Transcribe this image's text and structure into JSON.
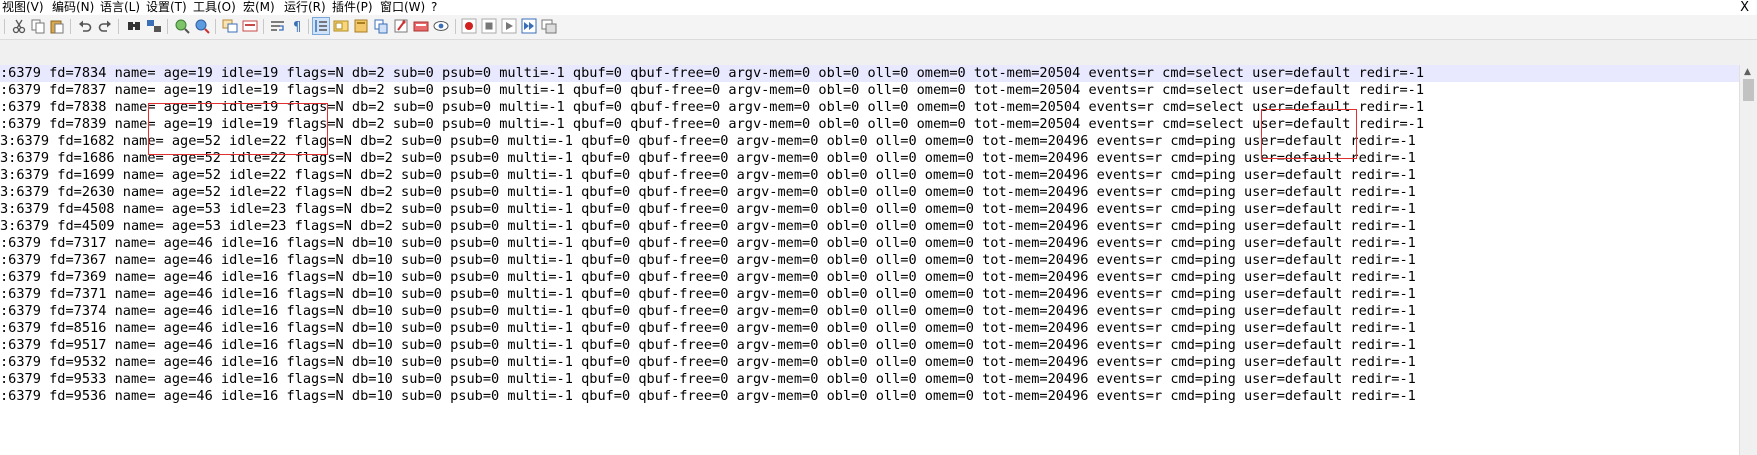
{
  "menu": [
    "视图(V)",
    "编码(N)",
    "语言(L)",
    "设置(T)",
    "工具(O)",
    "宏(M)",
    "运行(R)",
    "插件(P)",
    "窗口(W)",
    "?"
  ],
  "window_close": "X",
  "toolbar_icons": [
    "cut-icon",
    "copy-icon",
    "paste-icon",
    "undo-icon",
    "redo-icon",
    "find-icon",
    "replace-icon",
    "zoom-in-icon",
    "zoom-out-icon",
    "sync-vertical-icon",
    "sync-horizontal-icon",
    "word-wrap-icon",
    "show-all-chars-icon",
    "indent-guide-icon",
    "user-defined-language-icon",
    "document-map-icon",
    "function-list-icon",
    "folder-workspace-icon",
    "document-list-icon",
    "monitoring-icon",
    "record-macro-icon",
    "stop-recording-icon",
    "playback-macro-icon",
    "run-macro-multiple-icon",
    "save-macro-icon"
  ],
  "lines": [
    ":6379 fd=7834 name= age=19 idle=19 flags=N db=2 sub=0 psub=0 multi=-1 qbuf=0 qbuf-free=0 argv-mem=0 obl=0 oll=0 omem=0 tot-mem=20504 events=r cmd=select user=default redir=-1",
    ":6379 fd=7837 name= age=19 idle=19 flags=N db=2 sub=0 psub=0 multi=-1 qbuf=0 qbuf-free=0 argv-mem=0 obl=0 oll=0 omem=0 tot-mem=20504 events=r cmd=select user=default redir=-1",
    ":6379 fd=7838 name= age=19 idle=19 flags=N db=2 sub=0 psub=0 multi=-1 qbuf=0 qbuf-free=0 argv-mem=0 obl=0 oll=0 omem=0 tot-mem=20504 events=r cmd=select user=default redir=-1",
    ":6379 fd=7839 name= age=19 idle=19 flags=N db=2 sub=0 psub=0 multi=-1 qbuf=0 qbuf-free=0 argv-mem=0 obl=0 oll=0 omem=0 tot-mem=20504 events=r cmd=select user=default redir=-1",
    "3:6379 fd=1682 name= age=52 idle=22 flags=N db=2 sub=0 psub=0 multi=-1 qbuf=0 qbuf-free=0 argv-mem=0 obl=0 oll=0 omem=0 tot-mem=20496 events=r cmd=ping user=default redir=-1",
    "3:6379 fd=1686 name= age=52 idle=22 flags=N db=2 sub=0 psub=0 multi=-1 qbuf=0 qbuf-free=0 argv-mem=0 obl=0 oll=0 omem=0 tot-mem=20496 events=r cmd=ping user=default redir=-1",
    "3:6379 fd=1699 name= age=52 idle=22 flags=N db=2 sub=0 psub=0 multi=-1 qbuf=0 qbuf-free=0 argv-mem=0 obl=0 oll=0 omem=0 tot-mem=20496 events=r cmd=ping user=default redir=-1",
    "3:6379 fd=2630 name= age=52 idle=22 flags=N db=2 sub=0 psub=0 multi=-1 qbuf=0 qbuf-free=0 argv-mem=0 obl=0 oll=0 omem=0 tot-mem=20496 events=r cmd=ping user=default redir=-1",
    "3:6379 fd=4508 name= age=53 idle=23 flags=N db=2 sub=0 psub=0 multi=-1 qbuf=0 qbuf-free=0 argv-mem=0 obl=0 oll=0 omem=0 tot-mem=20496 events=r cmd=ping user=default redir=-1",
    "3:6379 fd=4509 name= age=53 idle=23 flags=N db=2 sub=0 psub=0 multi=-1 qbuf=0 qbuf-free=0 argv-mem=0 obl=0 oll=0 omem=0 tot-mem=20496 events=r cmd=ping user=default redir=-1",
    ":6379 fd=7317 name= age=46 idle=16 flags=N db=10 sub=0 psub=0 multi=-1 qbuf=0 qbuf-free=0 argv-mem=0 obl=0 oll=0 omem=0 tot-mem=20496 events=r cmd=ping user=default redir=-1",
    ":6379 fd=7367 name= age=46 idle=16 flags=N db=10 sub=0 psub=0 multi=-1 qbuf=0 qbuf-free=0 argv-mem=0 obl=0 oll=0 omem=0 tot-mem=20496 events=r cmd=ping user=default redir=-1",
    ":6379 fd=7369 name= age=46 idle=16 flags=N db=10 sub=0 psub=0 multi=-1 qbuf=0 qbuf-free=0 argv-mem=0 obl=0 oll=0 omem=0 tot-mem=20496 events=r cmd=ping user=default redir=-1",
    ":6379 fd=7371 name= age=46 idle=16 flags=N db=10 sub=0 psub=0 multi=-1 qbuf=0 qbuf-free=0 argv-mem=0 obl=0 oll=0 omem=0 tot-mem=20496 events=r cmd=ping user=default redir=-1",
    ":6379 fd=7374 name= age=46 idle=16 flags=N db=10 sub=0 psub=0 multi=-1 qbuf=0 qbuf-free=0 argv-mem=0 obl=0 oll=0 omem=0 tot-mem=20496 events=r cmd=ping user=default redir=-1",
    ":6379 fd=8516 name= age=46 idle=16 flags=N db=10 sub=0 psub=0 multi=-1 qbuf=0 qbuf-free=0 argv-mem=0 obl=0 oll=0 omem=0 tot-mem=20496 events=r cmd=ping user=default redir=-1",
    ":6379 fd=9517 name= age=46 idle=16 flags=N db=10 sub=0 psub=0 multi=-1 qbuf=0 qbuf-free=0 argv-mem=0 obl=0 oll=0 omem=0 tot-mem=20496 events=r cmd=ping user=default redir=-1",
    ":6379 fd=9532 name= age=46 idle=16 flags=N db=10 sub=0 psub=0 multi=-1 qbuf=0 qbuf-free=0 argv-mem=0 obl=0 oll=0 omem=0 tot-mem=20496 events=r cmd=ping user=default redir=-1",
    ":6379 fd=9533 name= age=46 idle=16 flags=N db=10 sub=0 psub=0 multi=-1 qbuf=0 qbuf-free=0 argv-mem=0 obl=0 oll=0 omem=0 tot-mem=20496 events=r cmd=ping user=default redir=-1",
    ":6379 fd=9536 name= age=46 idle=16 flags=N db=10 sub=0 psub=0 multi=-1 qbuf=0 qbuf-free=0 argv-mem=0 obl=0 oll=0 omem=0 tot-mem=20496 events=r cmd=ping user=default redir=-1"
  ],
  "current_line_index": 0,
  "colors": {
    "current_line": "#e8e8ff",
    "annotation_box": "#e03030",
    "toolbar_bg": "#f4f4f4"
  }
}
